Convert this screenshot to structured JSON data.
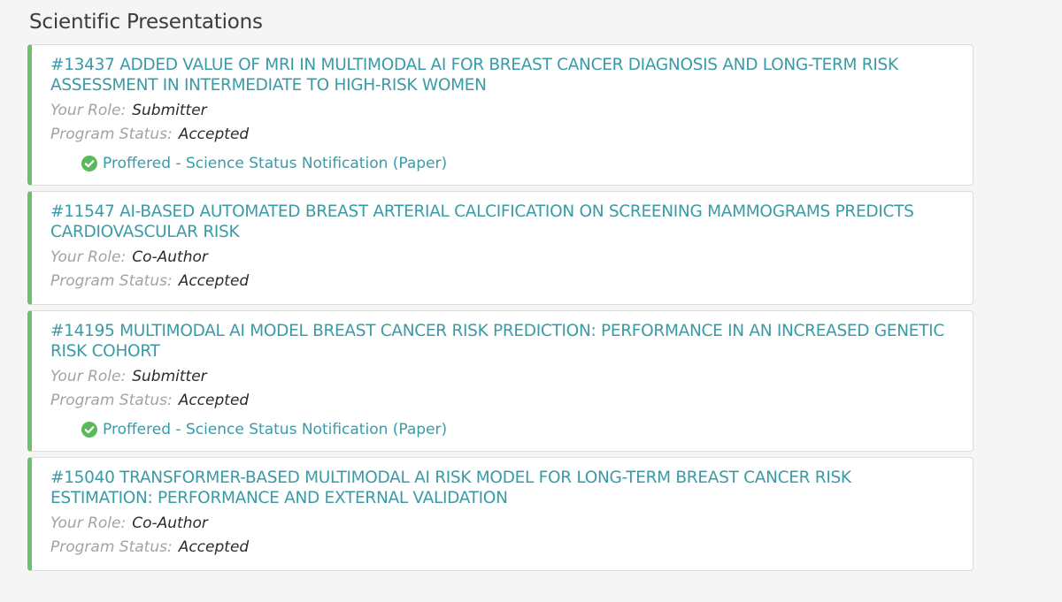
{
  "section": {
    "title": "Scientific Presentations"
  },
  "labels": {
    "role": "Your Role:",
    "status": "Program Status:"
  },
  "colors": {
    "accent_border": "#6cbf6c",
    "link": "#3a9ba6",
    "check": "#5cb85c"
  },
  "presentations": [
    {
      "title": "#13437 ADDED VALUE OF MRI IN MULTIMODAL AI FOR BREAST CANCER DIAGNOSIS AND LONG-TERM RISK ASSESSMENT IN INTERMEDIATE TO HIGH-RISK WOMEN",
      "role": "Submitter",
      "status": "Accepted",
      "notification": "Proffered - Science Status Notification (Paper)",
      "notification_icon": "check-circle-icon"
    },
    {
      "title": "#11547 AI-BASED AUTOMATED BREAST ARTERIAL CALCIFICATION ON SCREENING MAMMOGRAMS PREDICTS CARDIOVASCULAR RISK",
      "role": "Co-Author",
      "status": "Accepted"
    },
    {
      "title": "#14195 MULTIMODAL AI MODEL BREAST CANCER RISK PREDICTION: PERFORMANCE IN AN INCREASED GENETIC RISK COHORT",
      "role": "Submitter",
      "status": "Accepted",
      "notification": "Proffered - Science Status Notification (Paper)",
      "notification_icon": "check-circle-icon"
    },
    {
      "title": "#15040 TRANSFORMER-BASED MULTIMODAL AI RISK MODEL FOR LONG-TERM BREAST CANCER RISK ESTIMATION: PERFORMANCE AND EXTERNAL VALIDATION",
      "role": "Co-Author",
      "status": "Accepted"
    }
  ]
}
